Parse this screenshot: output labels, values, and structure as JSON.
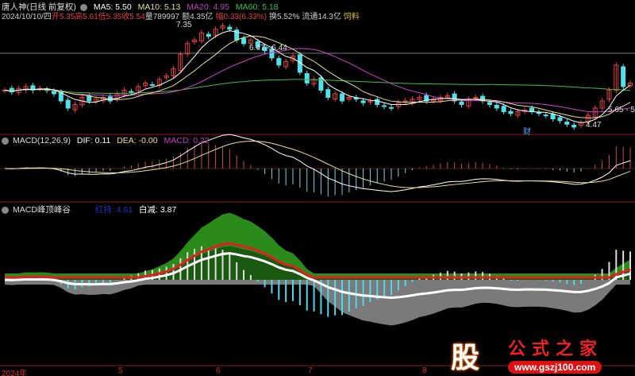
{
  "main": {
    "title": "唐人神(日线 前复权)",
    "ma5": "MA5: 5.50",
    "ma10": "MA10: 5.13",
    "ma20": "MA20: 4.95",
    "ma60": "MA60: 5.18",
    "date": "2024/10/10/四",
    "open": "开5.35",
    "high": "高5.61",
    "low": "低5.35",
    "close": "收5.54",
    "vol": "量789997",
    "amount": "额4.35亿",
    "change": "幅0.33(6.33%)",
    "turnover": "换5.52%",
    "float": "流通14.3亿",
    "industry": "饲料",
    "ann_high": "7.35",
    "ann_range": "6.47 - 6.44",
    "ann_low": "4.47",
    "ann_right": "5.65 - 5",
    "ann_cai": "财"
  },
  "macd": {
    "title": "MACD(12,26,9)",
    "dif": "DIF: 0.11",
    "dea": "DEA: -0.00",
    "macd": "MACD: 0.22"
  },
  "peak": {
    "title": "MACD峰顶峰谷",
    "red": "红持: 4.61",
    "white": "白减: 3.87"
  },
  "axis": [
    "2024年",
    "5",
    "6",
    "7",
    "8"
  ],
  "watermark": {
    "logo": "股",
    "name": "公式之家",
    "url": "www.gszj100.com"
  },
  "colors": {
    "up": "#e04040",
    "down": "#54e0e8",
    "ma5": "#ffffff",
    "ma10": "#e8e090",
    "ma20": "#d040d0",
    "ma60": "#40c040"
  },
  "chart_data": {
    "type": "candlestick",
    "closes": [
      5.5,
      5.45,
      5.55,
      5.6,
      5.5,
      5.55,
      5.5,
      5.4,
      5.2,
      5.0,
      5.1,
      5.3,
      5.2,
      5.25,
      5.3,
      5.2,
      5.4,
      5.5,
      5.45,
      5.6,
      5.7,
      5.65,
      5.8,
      5.9,
      6.1,
      6.5,
      6.8,
      6.9,
      7.1,
      7.0,
      7.2,
      7.3,
      7.2,
      6.9,
      6.8,
      6.9,
      6.7,
      6.6,
      6.4,
      6.2,
      6.3,
      6.45,
      6.0,
      5.7,
      5.8,
      5.5,
      5.3,
      5.4,
      5.2,
      5.3,
      5.25,
      5.15,
      5.2,
      5.1,
      5.05,
      5.0,
      5.15,
      5.2,
      5.25,
      5.3,
      5.2,
      5.25,
      5.3,
      5.35,
      5.2,
      5.1,
      5.25,
      5.3,
      5.2,
      5.1,
      5.0,
      4.9,
      4.85,
      4.9,
      4.95,
      4.9,
      4.85,
      4.8,
      4.7,
      4.65,
      4.55,
      4.47,
      4.6,
      4.8,
      5.0,
      5.2,
      5.5,
      6.2,
      5.6,
      5.7
    ]
  }
}
